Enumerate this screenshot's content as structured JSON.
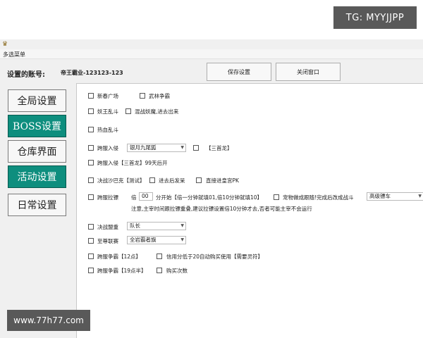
{
  "watermarks": {
    "tg": "TG: MYYJJPP",
    "site": "www.77h77.com"
  },
  "menubar": {
    "menu": "多选菜单"
  },
  "account": {
    "label": "设置的账号:",
    "value": "帝王霸业-123123-123"
  },
  "buttons": {
    "save": "保存设置",
    "close": "关闭窗口"
  },
  "sidebar": {
    "items": [
      "全局设置",
      "BOSS设置",
      "仓库界面",
      "活动设置",
      "日常设置"
    ]
  },
  "panel": {
    "xinchun": "新春广场",
    "wulin": "武林争霸",
    "yaowang": "妖王乱斗",
    "hunzhan": "混战妖魔,进去出来",
    "rexue": "热血乱斗",
    "kuafu_ruqin": "跨服入侵",
    "kuafu_ruqin_combo": "银月九尾狐",
    "sanshoulong_1": "【三首龙】",
    "kuafu_ruqin_sanshou": "跨服入侵【三首龙】99天后开",
    "juezhan_shabake": "决战沙巴克【测试】",
    "jinqu_fafa": "进去后发呆",
    "zhijie_huanggong": "直接进皇宫PK",
    "kuafu_labiao": "跨服拉镖",
    "bei": "倍",
    "bei_value": "00",
    "fen_kaishi": "分开始【倍一分钟就填01,倍10分钟就填10】",
    "chongwu": "宠物做成跟随!完成后改成战斗",
    "chongwu_combo": "高级镖车",
    "zhuyi": "注意,主宰时间跟拉镖重叠,建议拉镖设置倍10分钟才去,否者可能主宰不会运行",
    "juezhan_mengzhong": "决战盟重",
    "mengzhong_combo": "队长",
    "zhizun_liansai": "至尊联赛",
    "liansai_combo": "全岩霸者旗",
    "kuafu_zhengba_12": "跨服争霸【12点】",
    "xinyong": "信用分低于20自动购买使用【需要灵符】",
    "kuafu_zhengba_19": "跨服争霸【19点半】",
    "goumai": "购买次数"
  }
}
